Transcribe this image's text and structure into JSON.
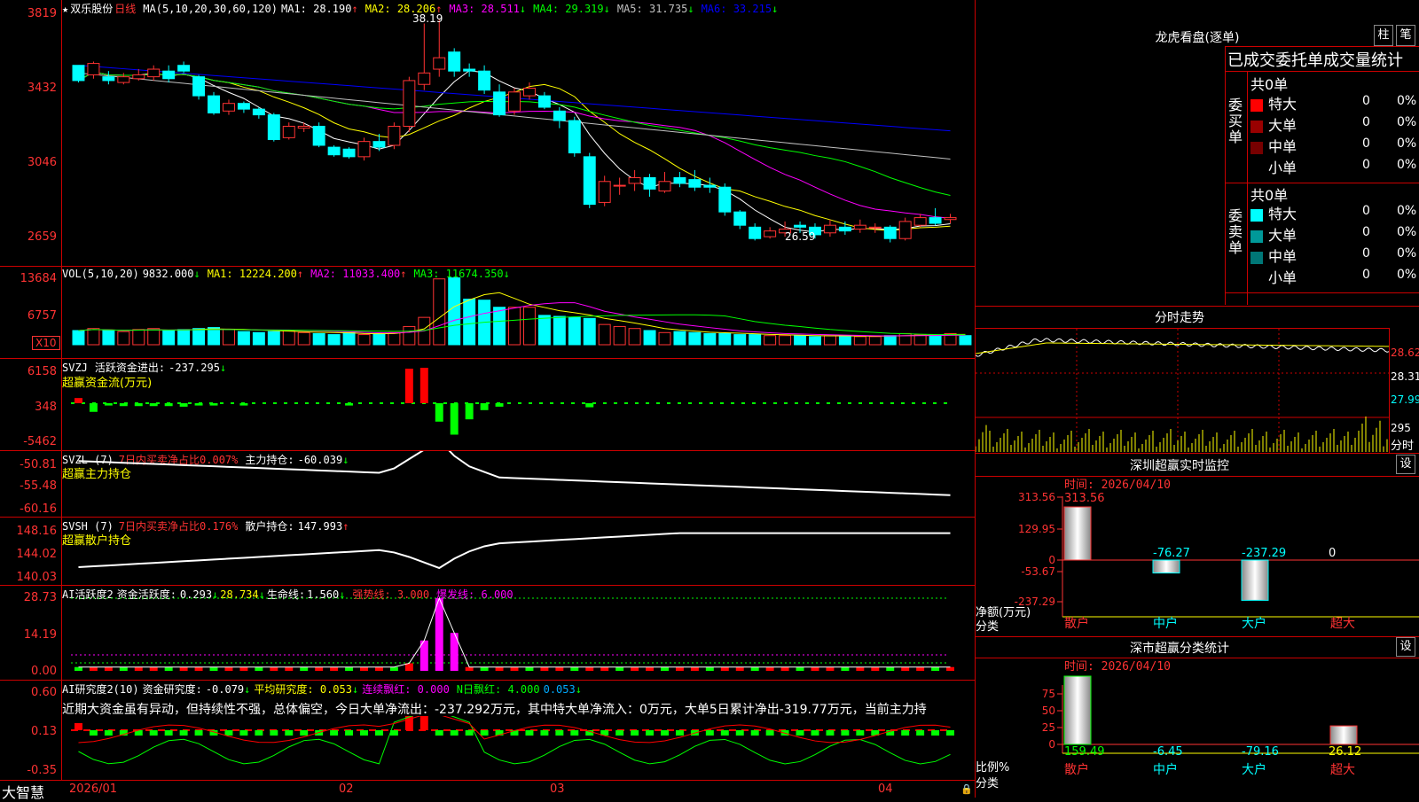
{
  "stock": {
    "star": "★",
    "name": "双乐股份",
    "period": "日线"
  },
  "ma_header": {
    "name": "MA(5,10,20,30,60,120)",
    "items": [
      {
        "label": "MA1:",
        "value": "28.190",
        "trend": "↑",
        "color": "#ffffff"
      },
      {
        "label": "MA2:",
        "value": "28.206",
        "trend": "↑",
        "color": "#ffff00"
      },
      {
        "label": "MA3:",
        "value": "28.511",
        "trend": "↓",
        "color": "#ff00ff"
      },
      {
        "label": "MA4:",
        "value": "29.319",
        "trend": "↓",
        "color": "#00ff00"
      },
      {
        "label": "MA5:",
        "value": "31.735",
        "trend": "↓",
        "color": "#c0c0c0"
      },
      {
        "label": "MA6:",
        "value": "33.215",
        "trend": "↓",
        "color": "#0000ff"
      }
    ]
  },
  "price_axis": [
    "3819",
    "3432",
    "3046",
    "2659"
  ],
  "price_high_label": "38.19",
  "price_low_label": "26.59",
  "vol_header": {
    "name": "VOL(5,10,20)",
    "value": "9832.000",
    "trend": "↓",
    "items": [
      {
        "label": "MA1:",
        "value": "12224.200",
        "trend": "↑",
        "color": "#ffff00"
      },
      {
        "label": "MA2:",
        "value": "11033.400",
        "trend": "↑",
        "color": "#ff00ff"
      },
      {
        "label": "MA3:",
        "value": "11674.350",
        "trend": "↓",
        "color": "#00ff00"
      }
    ]
  },
  "vol_axis": [
    "13684",
    "6757"
  ],
  "vol_unit": "X10",
  "svzj": {
    "name": "SVZJ",
    "label": "活跃资金进出:",
    "value": "-237.295",
    "trend": "↓",
    "subtitle": "超赢资金流(万元)",
    "axis": [
      "6158",
      "348",
      "-5462"
    ]
  },
  "svzl": {
    "name": "SVZL (7)",
    "ratio": "7日内买卖净占比0.007%",
    "label": "主力持仓:",
    "value": "-60.039",
    "trend": "↓",
    "subtitle": "超赢主力持仓",
    "axis": [
      "-50.81",
      "-55.48",
      "-60.16"
    ]
  },
  "svsh": {
    "name": "SVSH (7)",
    "ratio": "7日内买卖净占比0.176%",
    "label": "散户持仓:",
    "value": "147.993",
    "trend": "↑",
    "subtitle": "超赢散户持仓",
    "axis": [
      "148.16",
      "144.02",
      "140.03"
    ]
  },
  "ai_active": {
    "name": "AI活跃度2",
    "label": "资金活跃度:",
    "value": "0.293",
    "trend": "↓",
    "extra": "28.734",
    "extra_trend": "↓",
    "life_label": "生命线:",
    "life_value": "1.560",
    "strong": "强势线: 3.000",
    "burst": "爆发线: 6.000",
    "axis": [
      "28.73",
      "14.19",
      "0.00"
    ]
  },
  "ai_research": {
    "name": "AI研究度2(10)",
    "label": "资金研究度:",
    "value": "-0.079",
    "trend": "↓",
    "avg": "平均研究度: 0.053",
    "avg_trend": "↓",
    "red": "连续飘红: 0.000",
    "nred": "N日飘红: 4.000",
    "nred2": "0.053",
    "nred2_trend": "↓",
    "axis": [
      "0.60",
      "0.13",
      "-0.35"
    ],
    "comment": "近期大资金虽有异动，但持续性不强，总体偏空，今日大单净流出：-237.292万元，其中特大单净流入：0万元，大单5日累计净出-319.77万元，当前主力持"
  },
  "x_axis": [
    "2026/01",
    "02",
    "03",
    "04"
  ],
  "brand": "大智慧",
  "dragon": {
    "title": "龙虎看盘(逐单)",
    "btn1": "柱",
    "btn2": "笔",
    "table_title": "已成交委托单成交量统计",
    "buy": {
      "group": "委买单",
      "total": "共0单",
      "rows": [
        {
          "name": "特大",
          "count": "0",
          "pct": "0%",
          "color": "#ff0000"
        },
        {
          "name": "大单",
          "count": "0",
          "pct": "0%",
          "color": "#990000"
        },
        {
          "name": "中单",
          "count": "0",
          "pct": "0%",
          "color": "#770000"
        },
        {
          "name": "小单",
          "count": "0",
          "pct": "0%",
          "color": "#000000"
        }
      ]
    },
    "sell": {
      "group": "委卖单",
      "total": "共0单",
      "rows": [
        {
          "name": "特大",
          "count": "0",
          "pct": "0%",
          "color": "#00ffff"
        },
        {
          "name": "大单",
          "count": "0",
          "pct": "0%",
          "color": "#009999"
        },
        {
          "name": "中单",
          "count": "0",
          "pct": "0%",
          "color": "#007777"
        },
        {
          "name": "小单",
          "count": "0",
          "pct": "0%",
          "color": "#000000"
        }
      ]
    }
  },
  "intraday": {
    "title": "分时走势",
    "axis": [
      "28.62",
      "28.31",
      "27.99",
      "295"
    ],
    "unit": "分时"
  },
  "sz_monitor": {
    "title": "深圳超赢实时监控",
    "btn": "设",
    "time": "时间: 2026/04/10",
    "axis": [
      "313.56",
      "129.95",
      "0",
      "-53.67",
      "-237.29"
    ],
    "ylabel": "净额(万元)",
    "xlabel": "分类",
    "cats": [
      "散户",
      "中户",
      "大户",
      "超大"
    ],
    "values": [
      313.56,
      -76.27,
      -237.29,
      0
    ],
    "labels": [
      "313.56",
      "-76.27",
      "-237.29",
      "0"
    ]
  },
  "sz_class": {
    "title": "深市超赢分类统计",
    "btn": "设",
    "time": "时间: 2026/04/10",
    "axis": [
      "75",
      "50",
      "25",
      "0"
    ],
    "ylabel": "比例%",
    "xlabel": "分类",
    "cats": [
      "散户",
      "中户",
      "大户",
      "超大"
    ],
    "values": [
      159.49,
      -6.45,
      -79.16,
      26.12
    ],
    "labels": [
      "159.49",
      "-6.45",
      "-79.16",
      "26.12"
    ]
  },
  "candles": [
    [
      35.8,
      35.0,
      35.5,
      34.9
    ],
    [
      35.3,
      35.9,
      36.0,
      35.1
    ],
    [
      35.2,
      35.0,
      35.5,
      34.8
    ],
    [
      34.9,
      35.2,
      35.4,
      34.8
    ],
    [
      35.1,
      35.3,
      35.6,
      35.0
    ],
    [
      35.2,
      35.6,
      35.8,
      35.0
    ],
    [
      35.5,
      35.1,
      35.8,
      34.9
    ],
    [
      35.8,
      35.5,
      36.0,
      35.4
    ],
    [
      35.2,
      34.2,
      35.3,
      34.0
    ],
    [
      34.2,
      33.3,
      34.4,
      33.2
    ],
    [
      33.4,
      33.8,
      34.0,
      33.2
    ],
    [
      33.8,
      33.5,
      33.9,
      33.3
    ],
    [
      33.5,
      33.2,
      33.6,
      33.0
    ],
    [
      33.2,
      31.9,
      33.3,
      31.8
    ],
    [
      32.0,
      32.6,
      32.8,
      31.9
    ],
    [
      32.5,
      32.6,
      32.8,
      32.3
    ],
    [
      32.6,
      31.6,
      32.8,
      31.5
    ],
    [
      31.5,
      31.1,
      31.6,
      31.0
    ],
    [
      31.4,
      31.0,
      31.5,
      30.9
    ],
    [
      31.0,
      31.8,
      32.0,
      30.8
    ],
    [
      31.8,
      31.5,
      32.2,
      31.3
    ],
    [
      31.6,
      32.6,
      32.8,
      31.4
    ],
    [
      32.6,
      35.0,
      35.2,
      32.3
    ],
    [
      34.8,
      35.4,
      38.0,
      34.5
    ],
    [
      35.6,
      36.2,
      38.2,
      35.2
    ],
    [
      36.5,
      35.5,
      36.7,
      35.2
    ],
    [
      35.6,
      35.5,
      35.9,
      35.2
    ],
    [
      35.5,
      34.5,
      35.8,
      34.3
    ],
    [
      34.4,
      33.2,
      34.8,
      33.1
    ],
    [
      33.4,
      34.4,
      34.6,
      33.2
    ],
    [
      34.2,
      34.6,
      34.9,
      34.0
    ],
    [
      34.2,
      33.6,
      34.4,
      33.5
    ],
    [
      33.4,
      32.9,
      33.6,
      32.5
    ],
    [
      32.9,
      31.2,
      33.1,
      31.0
    ],
    [
      31.0,
      28.5,
      31.2,
      28.3
    ],
    [
      28.6,
      29.7,
      30.0,
      28.4
    ],
    [
      29.5,
      29.5,
      29.9,
      29.0
    ],
    [
      29.6,
      29.9,
      30.3,
      29.2
    ],
    [
      29.9,
      29.3,
      30.1,
      28.9
    ],
    [
      29.2,
      29.7,
      30.2,
      29.1
    ],
    [
      29.9,
      29.6,
      30.2,
      29.4
    ],
    [
      29.8,
      29.4,
      30.3,
      29.2
    ],
    [
      29.5,
      29.4,
      29.9,
      29.1
    ],
    [
      29.4,
      28.1,
      29.6,
      27.9
    ],
    [
      28.1,
      27.4,
      28.2,
      27.2
    ],
    [
      27.3,
      26.7,
      27.5,
      26.6
    ],
    [
      26.8,
      27.1,
      27.3,
      26.7
    ],
    [
      27.0,
      27.2,
      27.6,
      26.8
    ],
    [
      27.4,
      27.3,
      27.6,
      27.0
    ],
    [
      27.3,
      26.9,
      27.5,
      26.7
    ],
    [
      27.0,
      27.4,
      27.7,
      26.8
    ],
    [
      27.3,
      27.1,
      27.6,
      26.9
    ],
    [
      27.2,
      27.4,
      27.7,
      27.0
    ],
    [
      27.3,
      27.3,
      27.5,
      27.0
    ],
    [
      27.3,
      26.7,
      27.4,
      26.5
    ],
    [
      26.7,
      27.6,
      27.8,
      26.6
    ],
    [
      27.4,
      27.8,
      28.0,
      27.3
    ],
    [
      27.8,
      27.5,
      28.3,
      27.4
    ],
    [
      27.7,
      27.8,
      28.0,
      27.5
    ]
  ],
  "volumes": [
    14,
    16,
    14,
    13,
    15,
    16,
    14,
    15,
    16,
    17,
    15,
    13,
    12,
    13,
    14,
    12,
    11,
    10,
    12,
    10,
    11,
    12,
    18,
    27,
    65,
    66,
    45,
    44,
    37,
    37,
    37,
    29,
    28,
    27,
    26,
    20,
    18,
    16,
    14,
    12,
    13,
    12,
    11,
    11,
    10,
    10,
    9,
    9,
    9,
    8,
    9,
    9,
    8,
    8,
    9,
    11,
    10,
    10,
    11,
    9
  ],
  "fund_flow": [
    900,
    -1500,
    -400,
    -500,
    -500,
    -500,
    -500,
    -600,
    -400,
    -400,
    -300,
    -400,
    -300,
    -200,
    -300,
    -300,
    -200,
    -300,
    -400,
    -300,
    -300,
    -300,
    6000,
    6158,
    -3200,
    -5462,
    -2800,
    -1200,
    -600,
    -300,
    -300,
    -200,
    -300,
    -300,
    -700,
    -300,
    -200,
    -200,
    -300,
    -200,
    -200,
    -200,
    -200,
    -200,
    -200,
    -200,
    -200,
    -200,
    -200,
    -200,
    -200,
    -200,
    -200,
    -200,
    -200,
    -200,
    -200,
    -200,
    -237
  ]
}
